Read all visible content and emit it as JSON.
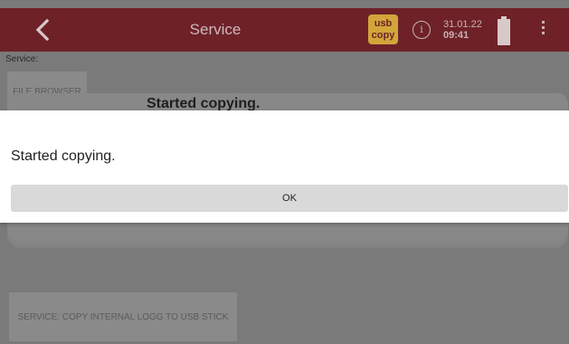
{
  "header": {
    "title": "Service",
    "usb_badge": {
      "line1": "usb",
      "line2": "copy"
    },
    "info_glyph": "i",
    "date": "31.01.22",
    "time": "09:41",
    "icons": [
      "back-icon",
      "info-icon",
      "battery-icon",
      "more-vert-icon"
    ]
  },
  "background": {
    "service_label": "Service:",
    "file_browser_label": "FILE BROWSER",
    "underlying_dialog_title": "Started copying.",
    "copy_logs_label": "SERVICE: COPY INTERNAL LOGG TO USB STICK"
  },
  "dialog": {
    "message": "Started copying.",
    "ok_label": "OK"
  },
  "colors": {
    "header_bg": "#6e2228",
    "usb_badge_bg": "#d2a63a",
    "overlay_bg": "#7a7a7a",
    "dialog_bg": "#ffffff",
    "ok_button_bg": "#d9d9d9"
  }
}
